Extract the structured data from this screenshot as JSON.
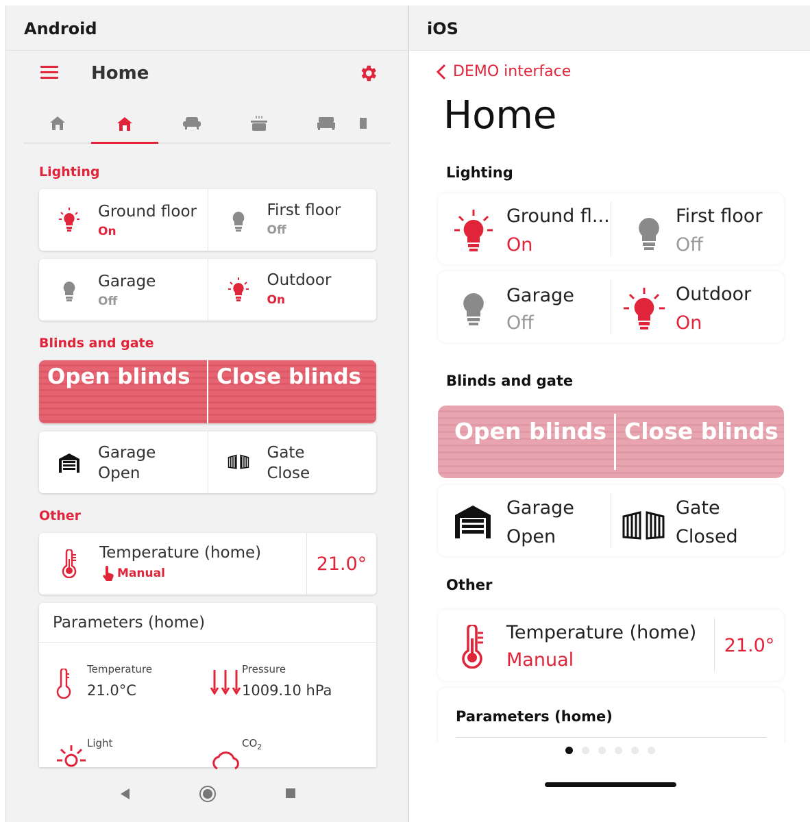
{
  "panels": {
    "android_label": "Android",
    "ios_label": "iOS"
  },
  "colors": {
    "accent": "#e0243a",
    "inactive": "#999999"
  },
  "android": {
    "title": "Home",
    "tabs": [
      "home-outline-icon",
      "home-icon",
      "sofa-icon",
      "pot-icon",
      "bed-icon",
      "more-icon"
    ],
    "active_tab": 1,
    "sections": {
      "lighting": "Lighting",
      "blinds": "Blinds and gate",
      "other": "Other"
    },
    "lights": [
      {
        "name": "Ground floor",
        "state": "On",
        "on": true
      },
      {
        "name": "First floor",
        "state": "Off",
        "on": false
      },
      {
        "name": "Garage",
        "state": "Off",
        "on": false
      },
      {
        "name": "Outdoor",
        "state": "On",
        "on": true
      }
    ],
    "blinds": {
      "open": "Open blinds",
      "close": "Close blinds"
    },
    "garage": {
      "name": "Garage",
      "state": "Open"
    },
    "gate": {
      "name": "Gate",
      "state": "Close"
    },
    "temperature": {
      "name": "Temperature (home)",
      "mode": "Manual",
      "value": "21.0°"
    },
    "parameters": {
      "title": "Parameters (home)",
      "items": [
        {
          "label": "Temperature",
          "value": "21.0°C"
        },
        {
          "label": "Pressure",
          "value": "1009.10 hPa"
        },
        {
          "label": "Light",
          "value": ""
        },
        {
          "label": "CO",
          "sub": "2",
          "value": ""
        }
      ]
    }
  },
  "ios": {
    "back_label": "DEMO interface",
    "title": "Home",
    "sections": {
      "lighting": "Lighting",
      "blinds": "Blinds and gate",
      "other": "Other"
    },
    "lights": [
      {
        "name": "Ground fl...",
        "state": "On",
        "on": true
      },
      {
        "name": "First floor",
        "state": "Off",
        "on": false
      },
      {
        "name": "Garage",
        "state": "Off",
        "on": false
      },
      {
        "name": "Outdoor",
        "state": "On",
        "on": true
      }
    ],
    "blinds": {
      "open": "Open blinds",
      "close": "Close blinds"
    },
    "garage": {
      "name": "Garage",
      "state": "Open"
    },
    "gate": {
      "name": "Gate",
      "state": "Closed"
    },
    "temperature": {
      "name": "Temperature (home)",
      "mode": "Manual",
      "value": "21.0°"
    },
    "parameters_title": "Parameters (home)",
    "page_dots": 6,
    "active_dot": 0
  }
}
